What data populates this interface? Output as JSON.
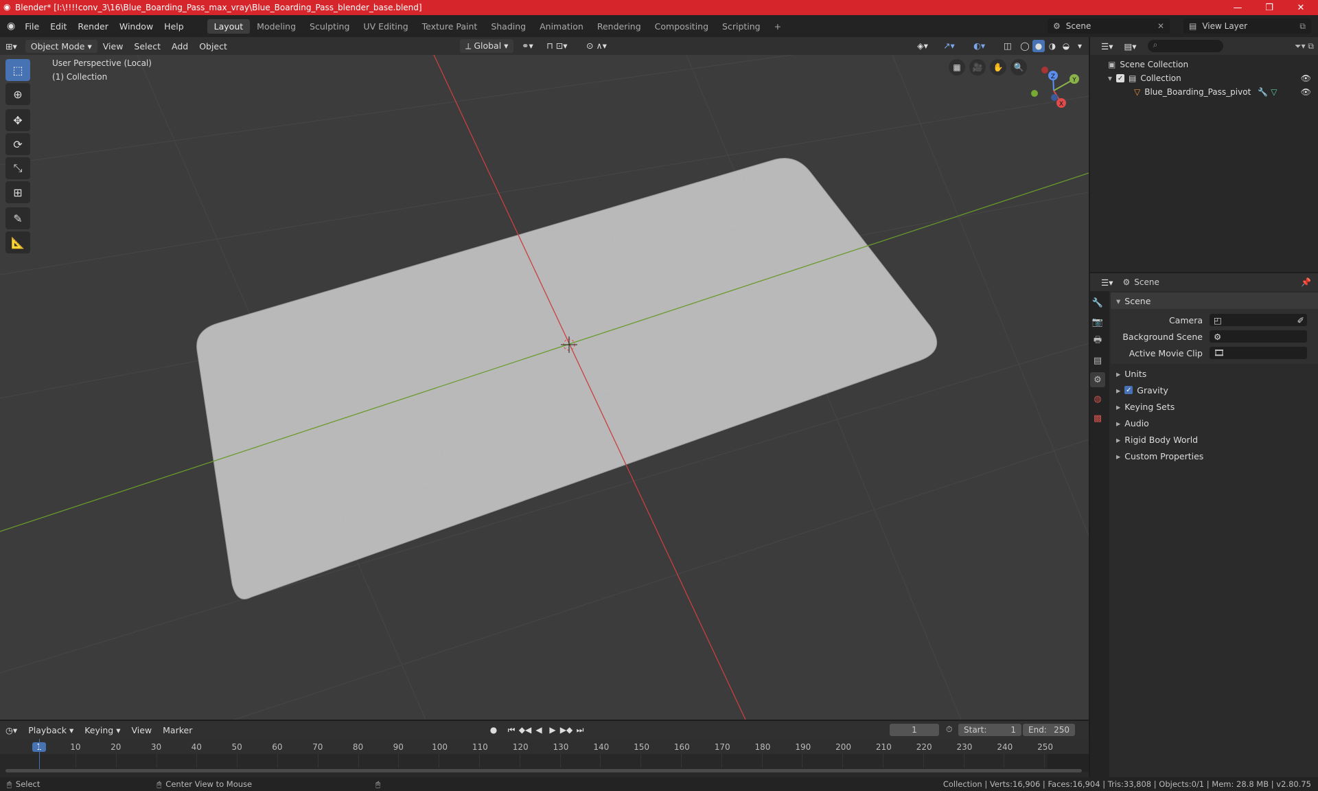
{
  "window": {
    "title": "Blender* [I:\\!!!!conv_3\\16\\Blue_Boarding_Pass_max_vray\\Blue_Boarding_Pass_blender_base.blend]"
  },
  "menu": [
    "File",
    "Edit",
    "Render",
    "Window",
    "Help"
  ],
  "workspaces": [
    "Layout",
    "Modeling",
    "Sculpting",
    "UV Editing",
    "Texture Paint",
    "Shading",
    "Animation",
    "Rendering",
    "Compositing",
    "Scripting"
  ],
  "scene_selector": "Scene",
  "view_layer": "View Layer",
  "viewport_header": {
    "mode": "Object Mode",
    "menus": [
      "View",
      "Select",
      "Add",
      "Object"
    ],
    "transform": "Global"
  },
  "viewport": {
    "perspective": "User Perspective (Local)",
    "collection": "(1) Collection",
    "gizmo": {
      "x": "X",
      "y": "Y",
      "z": "Z"
    }
  },
  "outliner": {
    "root": "Scene Collection",
    "collection": "Collection",
    "object": "Blue_Boarding_Pass_pivot"
  },
  "properties": {
    "header": "Scene",
    "panel": "Scene",
    "fields": [
      {
        "label": "Camera"
      },
      {
        "label": "Background Scene"
      },
      {
        "label": "Active Movie Clip"
      }
    ],
    "sections": [
      "Units",
      "Gravity",
      "Keying Sets",
      "Audio",
      "Rigid Body World",
      "Custom Properties"
    ]
  },
  "timeline": {
    "menus": [
      "Playback",
      "Keying",
      "View",
      "Marker"
    ],
    "current_frame": "1",
    "start_label": "Start:",
    "start": "1",
    "end_label": "End:",
    "end": "250",
    "ticks": [
      "1",
      "10",
      "20",
      "30",
      "40",
      "50",
      "60",
      "70",
      "80",
      "90",
      "100",
      "110",
      "120",
      "130",
      "140",
      "150",
      "160",
      "170",
      "180",
      "190",
      "200",
      "210",
      "220",
      "230",
      "240",
      "250"
    ]
  },
  "status": {
    "select": "Select",
    "center": "Center View to Mouse",
    "stats": "Collection | Verts:16,906 | Faces:16,904 | Tris:33,808 | Objects:0/1 | Mem: 28.8 MB | v2.80.75"
  }
}
